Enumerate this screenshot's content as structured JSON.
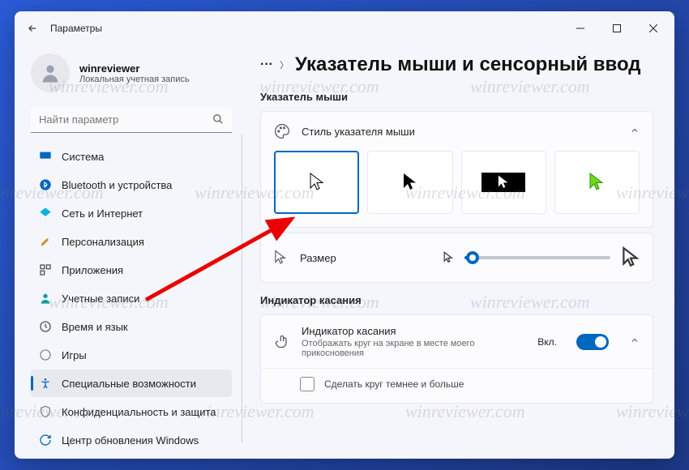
{
  "window": {
    "title": "Параметры"
  },
  "account": {
    "name": "winreviewer",
    "sub": "Локальная учетная запись"
  },
  "search": {
    "placeholder": "Найти параметр"
  },
  "nav": [
    {
      "key": "system",
      "label": "Система",
      "icon_color": "#0067c0"
    },
    {
      "key": "bluetooth",
      "label": "Bluetooth и устройства",
      "icon_color": "#0067c0"
    },
    {
      "key": "network",
      "label": "Сеть и Интернет",
      "icon_color": "#02b3e4"
    },
    {
      "key": "personalization",
      "label": "Персонализация",
      "icon_color": "#d28a2a"
    },
    {
      "key": "apps",
      "label": "Приложения",
      "icon_color": "#555"
    },
    {
      "key": "accounts",
      "label": "Учетные записи",
      "icon_color": "#0f9d9a"
    },
    {
      "key": "time",
      "label": "Время и язык",
      "icon_color": "#555"
    },
    {
      "key": "gaming",
      "label": "Игры",
      "icon_color": "#888"
    },
    {
      "key": "accessibility",
      "label": "Специальные возможности",
      "icon_color": "#0067c0",
      "selected": true
    },
    {
      "key": "privacy",
      "label": "Конфиденциальность и защита",
      "icon_color": "#888"
    },
    {
      "key": "update",
      "label": "Центр обновления Windows",
      "icon_color": "#0067c0"
    }
  ],
  "breadcrumb": {
    "title": "Указатель мыши и сенсорный ввод"
  },
  "sections": {
    "pointer": {
      "heading": "Указатель мыши",
      "style_card": {
        "label": "Стиль указателя мыши"
      },
      "size_card": {
        "label": "Размер"
      }
    },
    "touch": {
      "heading": "Индикатор касания",
      "card": {
        "label": "Индикатор касания",
        "sub": "Отображать круг на экране в месте моего прикосновения",
        "state": "Вкл.",
        "subrow": "Сделать круг темнее и больше"
      }
    }
  },
  "watermark": "winreviewer.com"
}
